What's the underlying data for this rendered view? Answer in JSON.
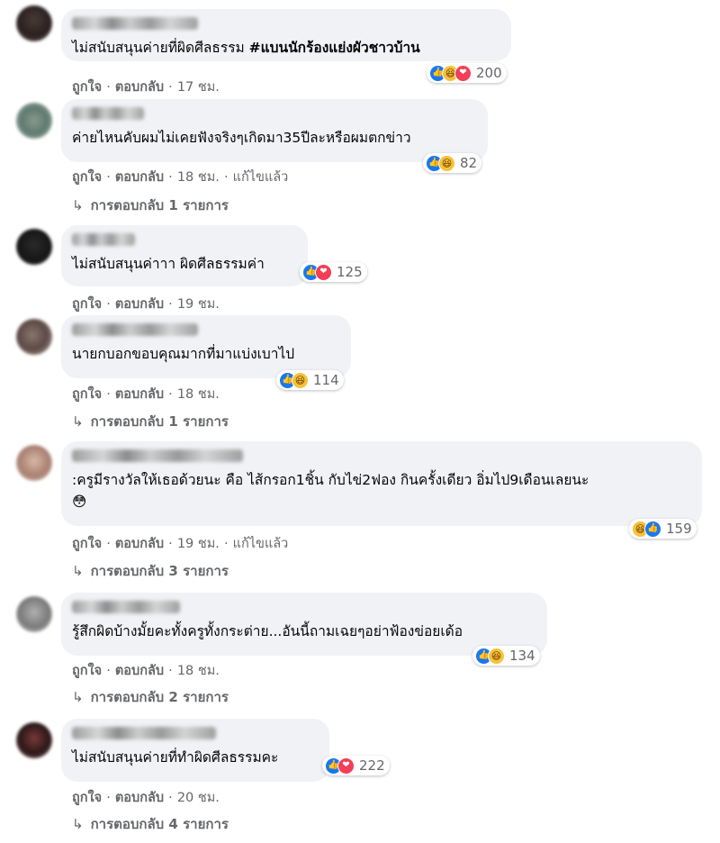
{
  "ui": {
    "like_label": "ถูกใจ",
    "reply_label": "ตอบกลับ",
    "separator": "·",
    "reply_arrow": "↳"
  },
  "comments": [
    {
      "text": "ไม่สนับสนุนค่ายที่ผิดศีลธรรม ",
      "hashtag": "#แบนนักร้องแย่งผัวชาวบ้าน",
      "reactions": [
        "like",
        "haha",
        "love"
      ],
      "count": "200",
      "time": "17 ชม.",
      "edited": "",
      "replies": ""
    },
    {
      "text": "ค่ายไหนคับผมไม่เคยฟังจริงๆเกิดมา35ปีละหรือผมตกข่าว",
      "reactions": [
        "like",
        "haha"
      ],
      "count": "82",
      "time": "18 ชม.",
      "edited": "แก้ไขแล้ว",
      "replies": "การตอบกลับ 1 รายการ"
    },
    {
      "text": "ไม่สนับสนุนค่าาา ผิดศีลธรรมค่า",
      "reactions": [
        "like",
        "love"
      ],
      "count": "125",
      "time": "19 ชม.",
      "edited": "",
      "replies": ""
    },
    {
      "text": "นายกบอกขอบคุณมากที่มาแบ่งเบาไป",
      "reactions": [
        "like",
        "haha"
      ],
      "count": "114",
      "time": "18 ชม.",
      "edited": "",
      "replies": "การตอบกลับ 1 รายการ"
    },
    {
      "text": ":ครูมีรางวัลให้เธอด้วยนะ คือ ไส้กรอก1ชิ้น กับไข่2ฟอง กินครั้งเดียว อิ่มไป9เดือนเลยนะ",
      "emoji": "😳",
      "reactions": [
        "haha",
        "like"
      ],
      "count": "159",
      "time": "19 ชม.",
      "edited": "แก้ไขแล้ว",
      "replies": "การตอบกลับ 3 รายการ"
    },
    {
      "text": "รู้สึกผิดบ้างมั้ยคะทั้งครูทั้งกระต่าย...อันนี้ถามเฉยๆอย่าฟ้องข่อยเด้อ",
      "reactions": [
        "like",
        "haha"
      ],
      "count": "134",
      "time": "18 ชม.",
      "edited": "",
      "replies": "การตอบกลับ 2 รายการ"
    },
    {
      "text": "ไม่สนับสนุนค่ายที่ทำผิดศีลธรรมคะ",
      "reactions": [
        "like",
        "love"
      ],
      "count": "222",
      "time": "20 ชม.",
      "edited": "",
      "replies": "การตอบกลับ 4 รายการ"
    }
  ],
  "colors": {
    "bubble": "#f0f2f5",
    "meta_text": "#65676b",
    "like_blue": "#1877f2",
    "haha_yellow": "#f7c23a",
    "love_red": "#f33e58"
  }
}
